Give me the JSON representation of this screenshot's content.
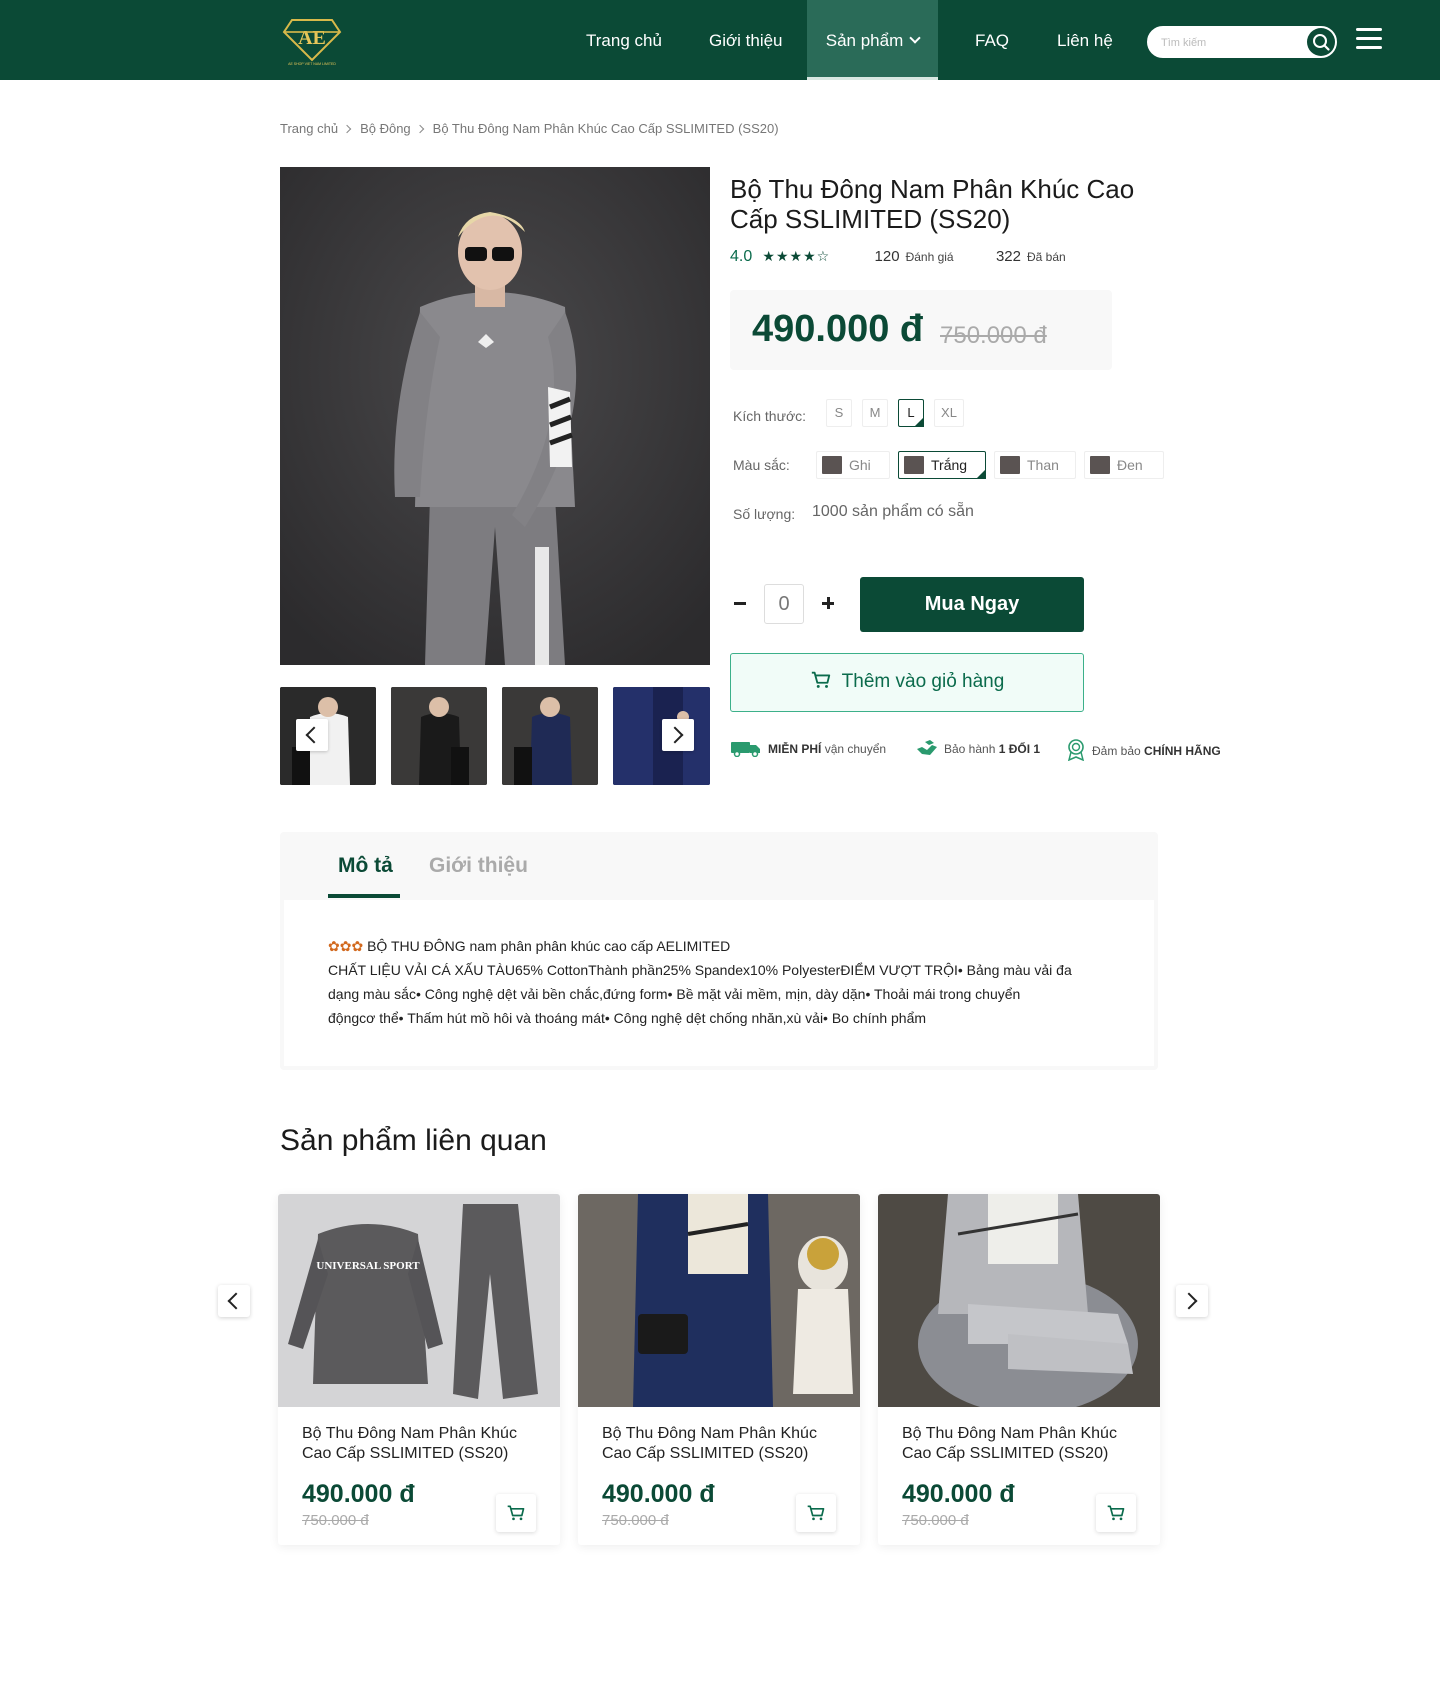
{
  "header": {
    "logo_text": "AE SHOP VIET NAM LIMITED",
    "nav": [
      {
        "label": "Trang chủ"
      },
      {
        "label": "Giới thiệu"
      },
      {
        "label": "Sản phẩm"
      },
      {
        "label": "FAQ"
      },
      {
        "label": "Liên hệ"
      }
    ],
    "search_placeholder": "Tìm kiếm",
    "colors": {
      "brand": "#0b4a36",
      "active_nav": "#2a6b58"
    }
  },
  "breadcrumb": [
    "Trang chủ",
    "Bộ Đông",
    "Bộ Thu Đông Nam Phân Khúc Cao Cấp SSLIMITED (SS20)"
  ],
  "product": {
    "title": "Bộ Thu Đông Nam Phân Khúc Cao Cấp SSLIMITED (SS20)",
    "rating": "4.0",
    "rating_stars": 4,
    "reviews_count": "120",
    "reviews_label": "Đánh giá",
    "sold_count": "322",
    "sold_label": "Đã bán",
    "price": "490.000 đ",
    "old_price": "750.000 đ",
    "size_label": "Kích thước:",
    "sizes": [
      "S",
      "M",
      "L",
      "XL"
    ],
    "selected_size": "L",
    "color_label": "Màu sắc:",
    "colors": [
      "Ghi",
      "Trắng",
      "Than",
      "Đen"
    ],
    "selected_color": "Trắng",
    "qty_label": "Số lượng:",
    "stock_text": "1000 sản phẩm có sẵn",
    "quantity": "0",
    "buy_label": "Mua Ngay",
    "add_cart_label": "Thêm vào giỏ hàng",
    "perks": [
      {
        "icon": "free-shipping-icon",
        "bold": "MIỄN PHÍ",
        "text": "vận chuyển"
      },
      {
        "icon": "warranty-icon",
        "text": "Bảo hành",
        "bold": "1 ĐỔI 1"
      },
      {
        "icon": "certified-icon",
        "text": "Đảm bảo",
        "bold": "CHÍNH HÃNG"
      }
    ]
  },
  "tabs": {
    "items": [
      {
        "label": "Mô tả"
      },
      {
        "label": "Giới thiệu"
      }
    ],
    "active": "Mô tả",
    "description_lines": [
      "BỘ THU ĐÔNG nam phân phân khúc cao cấp AELIMITED",
      "CHẤT LIỆU VẢI CÁ XẤU TÀU65% CottonThành phần25% Spandex10% PolyesterĐIỂM VƯỢT TRỘI• Bảng màu vải đa",
      "dạng màu sắc• Công nghệ dệt vải bền chắc,đứng form• Bề mặt vải mềm, mịn, dày dặn• Thoải mái trong chuyển",
      "độngcơ thể• Thấm hút mồ hôi và thoáng mát• Công nghệ dệt chống nhăn,xù vải• Bo chính phẩm"
    ]
  },
  "related": {
    "title": "Sản phẩm liên quan",
    "cards": [
      {
        "title": "Bộ Thu Đông Nam Phân Khúc Cao Cấp SSLIMITED (SS20)",
        "price": "490.000 đ",
        "old_price": "750.000 đ",
        "print_text": "UNIVERSAL SPORT"
      },
      {
        "title": "Bộ Thu Đông Nam Phân Khúc Cao Cấp SSLIMITED (SS20)",
        "price": "490.000 đ",
        "old_price": "750.000 đ"
      },
      {
        "title": "Bộ Thu Đông Nam Phân Khúc Cao Cấp SSLIMITED (SS20)",
        "price": "490.000 đ",
        "old_price": "750.000 đ"
      }
    ]
  }
}
